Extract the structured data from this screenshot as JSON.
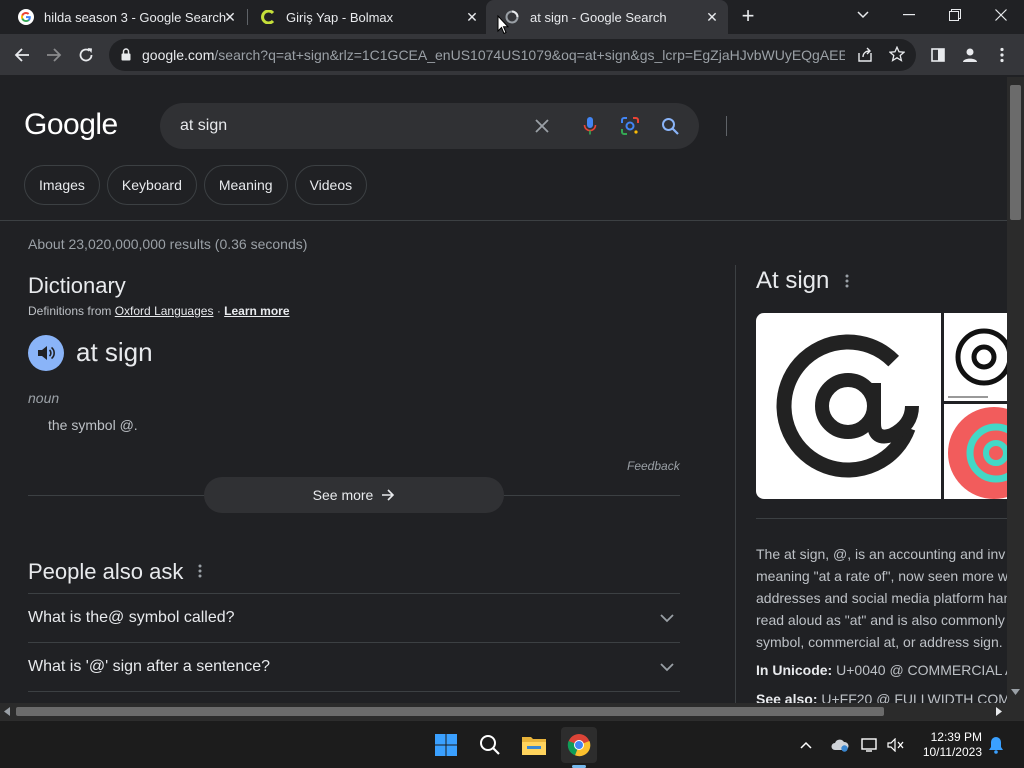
{
  "browser": {
    "tabs": [
      {
        "title": "hilda season 3 - Google Search",
        "icon": "google-favicon"
      },
      {
        "title": "Giriş Yap - Bolmax",
        "icon": "bolmax-favicon"
      },
      {
        "title": "at sign - Google Search",
        "icon": "loading-favicon",
        "active": true
      }
    ],
    "url_domain": "google.com",
    "url_rest": "/search?q=at+sign&rlz=1C1GCEA_enUS1074US1079&oq=at+sign&gs_lcrp=EgZjaHJvbWUyEQgAEE..."
  },
  "search": {
    "logo": "Google",
    "query": "at sign",
    "chips": [
      "Images",
      "Keyboard",
      "Meaning",
      "Videos"
    ],
    "result_stats": "About 23,020,000,000 results (0.36 seconds)"
  },
  "dictionary": {
    "title": "Dictionary",
    "source_prefix": "Definitions from",
    "source_link": "Oxford Languages",
    "separator": "·",
    "learn_more": "Learn more",
    "word": "at sign",
    "part_of_speech": "noun",
    "definition": "the symbol @.",
    "feedback": "Feedback",
    "see_more": "See more"
  },
  "people_also_ask": {
    "title": "People also ask",
    "questions": [
      "What is the@ symbol called?",
      "What is '@' sign after a sentence?"
    ]
  },
  "knowledge_panel": {
    "title": "At sign",
    "description_lines": [
      "The at sign, @, is an accounting and inv",
      "meaning \"at a rate of\", now seen more w",
      "addresses and social media platform han",
      "read aloud as \"at\" and is also commonly",
      "symbol, commercial at, or address sign."
    ],
    "unicode_label": "In Unicode:",
    "unicode_value": " U+0040 @ COMMERCIAL A",
    "see_also_label": "See also:",
    "see_also_value": " U+FF20 @ FULLWIDTH COM"
  },
  "taskbar": {
    "apps": [
      "windows-start-icon",
      "search-icon",
      "file-explorer-icon",
      "chrome-icon"
    ],
    "time": "12:39 PM",
    "date": "10/11/2023"
  },
  "colors": {
    "page_bg": "#202124",
    "accent_blue": "#8ab4f8",
    "text_primary": "#e8eaed"
  }
}
